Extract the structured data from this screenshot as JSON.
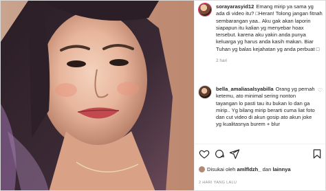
{
  "post": {
    "comments": [
      {
        "username": "sorayarasyid12",
        "text": "Emang mirip ya sama yg ada di video itu? □Heran! Tolong jangan fitnah sembarangan yaa.. Aku gak akan laporin siapapun itu kalian yg menyebar hoax tersebut. karena aku yakin anda punya keluarga yg harus anda kasih makan. Biar Tuhan yg balas kejahatan yg anda perbuat □",
        "time": "2 hari"
      },
      {
        "username": "bella_amaliasalsyabilla",
        "text": "Orang yg pernah ketemu, ato minimal sering nonton tayangan lo pasti tau itu bukan lo dan ga mirip.. Yg bilang mirip berarti cuma liat foto dan cut video di akun gosip ato akun joke yg kualitasnya burem + blur"
      }
    ],
    "likes": {
      "prefix": "Disukai oleh",
      "user": "amlfldzh_",
      "connector": "dan",
      "others": "lainnya"
    },
    "timestamp": "2 HARI YANG LALU",
    "icons": [
      "heart-icon",
      "comment-icon",
      "share-icon",
      "bookmark-icon"
    ],
    "colors": {
      "accent": "#e1306c",
      "muted": "#8e8e8e"
    }
  }
}
